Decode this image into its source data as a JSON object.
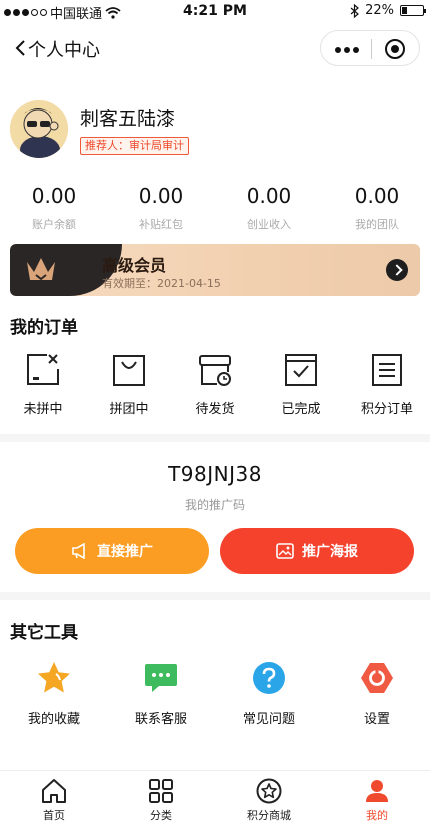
{
  "status_bar": {
    "carrier": "中国联通",
    "time": "4:21 PM",
    "battery": "22%"
  },
  "nav": {
    "title": "个人中心"
  },
  "profile": {
    "name": "刺客五陆漆",
    "referrer": "推荐人：审计局审计"
  },
  "stats": [
    {
      "value": "0.00",
      "label": "账户余额"
    },
    {
      "value": "0.00",
      "label": "补贴红包"
    },
    {
      "value": "0.00",
      "label": "创业收入"
    },
    {
      "value": "0.00",
      "label": "我的团队"
    }
  ],
  "vip": {
    "title": "高级会员",
    "expire": "有效期至：2021-04-15"
  },
  "orders": {
    "title": "我的订单",
    "items": [
      {
        "label": "未拼中",
        "icon": "unmatched-icon"
      },
      {
        "label": "拼团中",
        "icon": "bag-icon"
      },
      {
        "label": "待发货",
        "icon": "shipping-icon"
      },
      {
        "label": "已完成",
        "icon": "check-icon"
      },
      {
        "label": "积分订单",
        "icon": "list-icon"
      }
    ]
  },
  "promo": {
    "code": "T98JNJ38",
    "label": "我的推广码",
    "direct_button": "直接推广",
    "poster_button": "推广海报"
  },
  "tools": {
    "title": "其它工具",
    "items": [
      {
        "label": "我的收藏",
        "icon": "star-icon",
        "color": "#f5a623"
      },
      {
        "label": "联系客服",
        "icon": "chat-icon",
        "color": "#3dbb5e"
      },
      {
        "label": "常见问题",
        "icon": "help-icon",
        "color": "#2aa6e8"
      },
      {
        "label": "设置",
        "icon": "settings-icon",
        "color": "#f05a43"
      }
    ]
  },
  "tabbar": {
    "active_color": "#f04a2e",
    "items": [
      {
        "label": "首页",
        "icon": "home-icon"
      },
      {
        "label": "分类",
        "icon": "category-icon"
      },
      {
        "label": "积分商城",
        "icon": "points-mall-icon"
      },
      {
        "label": "我的",
        "icon": "profile-icon",
        "active": true
      }
    ]
  }
}
